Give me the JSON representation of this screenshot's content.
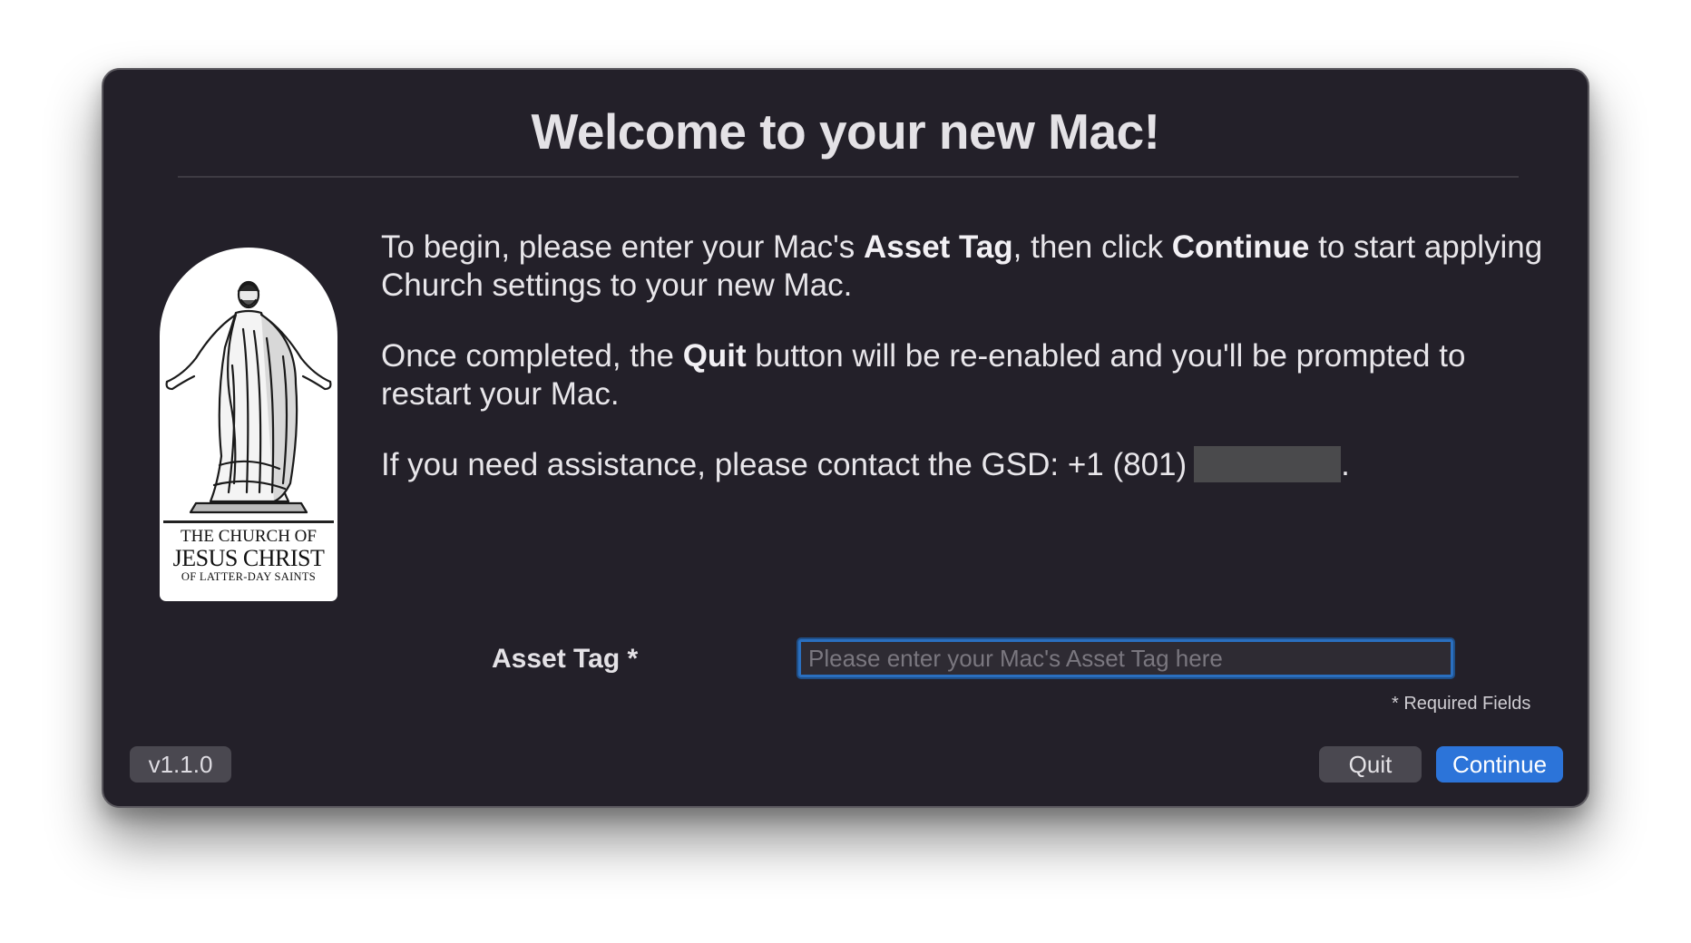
{
  "window": {
    "title": "Welcome to your new Mac!"
  },
  "logo": {
    "line1": "THE CHURCH OF",
    "line2": "JESUS CHRIST",
    "line3": "OF LATTER-DAY SAINTS"
  },
  "instructions": {
    "p1_a": "To begin, please enter your Mac's ",
    "p1_b": "Asset Tag",
    "p1_c": ", then click ",
    "p1_d": "Continue",
    "p1_e": " to start applying Church settings to your new Mac.",
    "p2_a": "Once completed, the ",
    "p2_b": "Quit",
    "p2_c": " button will be re-enabled and you'll be prompted to restart your Mac.",
    "p3_a": "If you need assistance, please contact the GSD: +1 (801)",
    "p3_b": "."
  },
  "form": {
    "asset_tag_label": "Asset Tag *",
    "asset_tag_value": "",
    "asset_tag_placeholder": "Please enter your Mac's Asset Tag here",
    "required_note": "* Required Fields"
  },
  "footer": {
    "version_label": "v1.1.0",
    "quit_label": "Quit",
    "continue_label": "Continue"
  },
  "colors": {
    "background": "#232029",
    "accent": "#2c74d9",
    "secondary_button": "#4a4850"
  }
}
